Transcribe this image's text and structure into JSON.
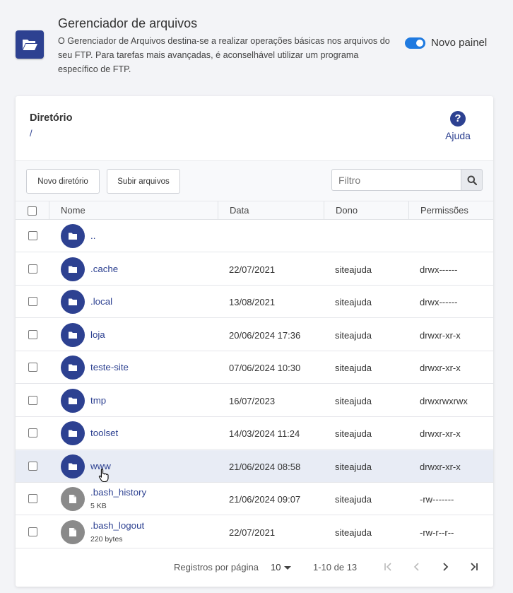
{
  "header": {
    "title": "Gerenciador de arquivos",
    "description": "O Gerenciador de Arquivos destina-se a realizar operações básicas nos arquivos do seu FTP. Para tarefas mais avançadas, é aconselhável utilizar um programa específico de FTP.",
    "toggle_label": "Novo painel",
    "toggle_on": true,
    "icon": "folder-open-icon"
  },
  "directory": {
    "label": "Diretório",
    "path": "/"
  },
  "help": {
    "label": "Ajuda",
    "icon": "question-circle-icon"
  },
  "toolbar": {
    "new_dir_label": "Novo diretório",
    "upload_label": "Subir arquivos",
    "filter_placeholder": "Filtro",
    "filter_icon": "search-icon"
  },
  "columns": {
    "name": "Nome",
    "date": "Data",
    "owner": "Dono",
    "permissions": "Permissões"
  },
  "rows": [
    {
      "name": "..",
      "type": "folder",
      "date": "",
      "owner": "",
      "permissions": "",
      "size": ""
    },
    {
      "name": ".cache",
      "type": "folder",
      "date": "22/07/2021",
      "owner": "siteajuda",
      "permissions": "drwx------",
      "size": ""
    },
    {
      "name": ".local",
      "type": "folder",
      "date": "13/08/2021",
      "owner": "siteajuda",
      "permissions": "drwx------",
      "size": ""
    },
    {
      "name": "loja",
      "type": "folder",
      "date": "20/06/2024 17:36",
      "owner": "siteajuda",
      "permissions": "drwxr-xr-x",
      "size": ""
    },
    {
      "name": "teste-site",
      "type": "folder",
      "date": "07/06/2024 10:30",
      "owner": "siteajuda",
      "permissions": "drwxr-xr-x",
      "size": ""
    },
    {
      "name": "tmp",
      "type": "folder",
      "date": "16/07/2023",
      "owner": "siteajuda",
      "permissions": "drwxrwxrwx",
      "size": ""
    },
    {
      "name": "toolset",
      "type": "folder",
      "date": "14/03/2024 11:24",
      "owner": "siteajuda",
      "permissions": "drwxr-xr-x",
      "size": ""
    },
    {
      "name": "www",
      "type": "folder",
      "date": "21/06/2024 08:58",
      "owner": "siteajuda",
      "permissions": "drwxr-xr-x",
      "size": "",
      "hover": true
    },
    {
      "name": ".bash_history",
      "type": "file",
      "date": "21/06/2024 09:07",
      "owner": "siteajuda",
      "permissions": "-rw-------",
      "size": "5 KB"
    },
    {
      "name": ".bash_logout",
      "type": "file",
      "date": "22/07/2021",
      "owner": "siteajuda",
      "permissions": "-rw-r--r--",
      "size": "220 bytes"
    }
  ],
  "pagination": {
    "per_page_label": "Registros por página",
    "per_page_value": "10",
    "range": "1-10 de 13"
  },
  "colors": {
    "brand": "#2d4191",
    "toggle": "#1f7ae0",
    "file_icon": "#8a8a8a",
    "row_hover": "#e8ecf5"
  }
}
